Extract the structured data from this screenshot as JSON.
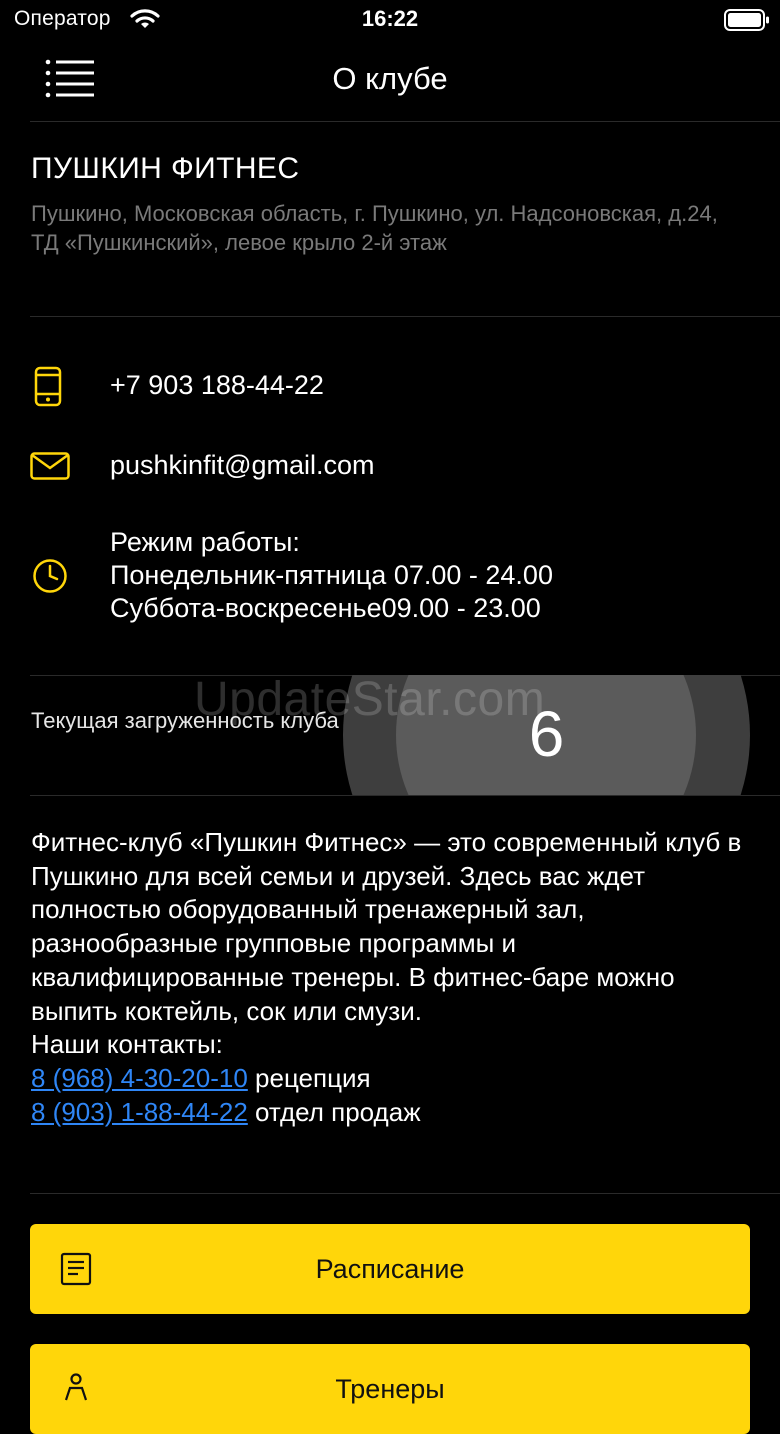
{
  "status_bar": {
    "carrier": "Оператор",
    "time": "16:22"
  },
  "nav": {
    "title": "О клубе",
    "menu_icon": "menu-icon"
  },
  "club": {
    "name": "ПУШКИН ФИТНЕС",
    "address": "Пушкино, Московская область, г. Пушкино, ул. Надсоновская, д.24, ТД «Пушкинский», левое крыло 2-й этаж"
  },
  "contacts": {
    "phone": "+7 903 188-44-22",
    "email": "pushkinfit@gmail.com",
    "hours_title": "Режим работы:",
    "hours_weekdays": "Понедельник-пятница 07.00 - 24.00",
    "hours_weekend": "Суббота-воскресенье09.00 - 23.00"
  },
  "load": {
    "label": "Текущая загруженность клуба",
    "value": "6"
  },
  "watermark": "UpdateStar.com",
  "description": {
    "text": "Фитнес-клуб «Пушкин Фитнес» — это современный клуб в Пушкино для всей семьи и друзей. Здесь вас ждет полностью оборудованный тренажерный зал, разнообразные групповые программы и квалифицированные тренеры. В фитнес-баре можно выпить коктейль, сок или смузи.",
    "contacts_heading": "Наши контакты:",
    "links": [
      {
        "phone": "8 (968) 4-30-20-10",
        "label": " рецепция"
      },
      {
        "phone": "8 (903) 1-88-44-22",
        "label": " отдел продаж"
      }
    ]
  },
  "buttons": {
    "schedule": "Расписание",
    "trainers": "Тренеры"
  },
  "colors": {
    "accent": "#ffd60a",
    "link": "#2f86f6",
    "muted": "#7a7a7a"
  }
}
